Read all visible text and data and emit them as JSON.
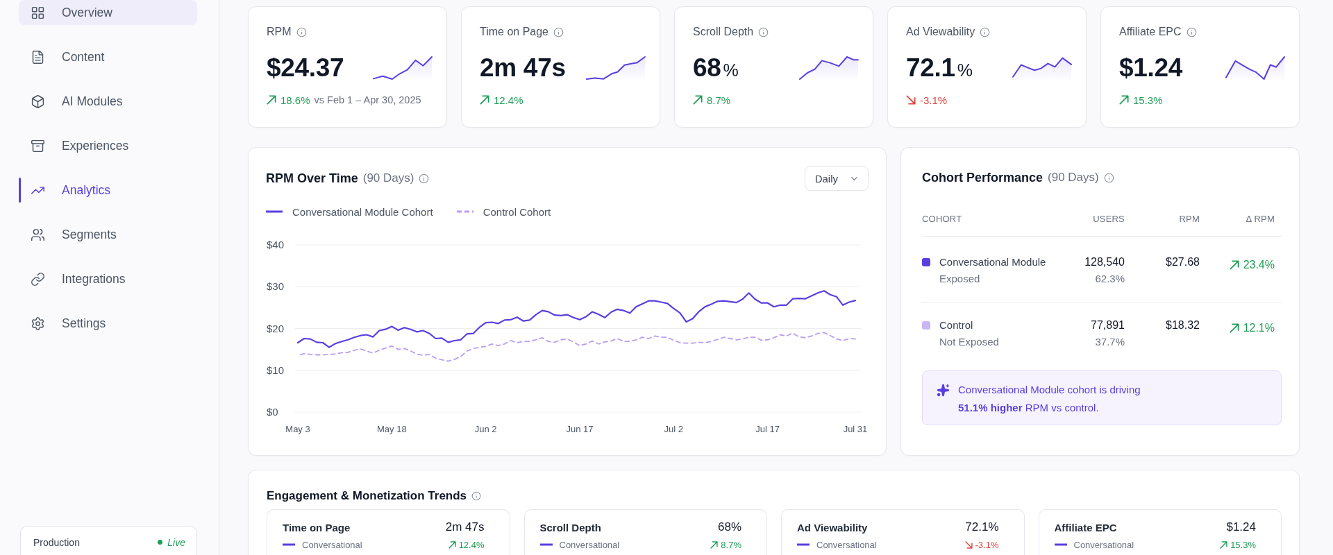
{
  "sidebar": {
    "items": [
      {
        "label": "Overview",
        "selected": false,
        "highlighted": true
      },
      {
        "label": "Content",
        "selected": false,
        "highlighted": false
      },
      {
        "label": "AI Modules",
        "selected": false,
        "highlighted": false
      },
      {
        "label": "Experiences",
        "selected": false,
        "highlighted": false
      },
      {
        "label": "Analytics",
        "selected": true,
        "highlighted": false
      },
      {
        "label": "Segments",
        "selected": false,
        "highlighted": false
      },
      {
        "label": "Integrations",
        "selected": false,
        "highlighted": false
      },
      {
        "label": "Settings",
        "selected": false,
        "highlighted": false
      }
    ],
    "environment": {
      "label": "Production",
      "status": "Live",
      "live": true
    }
  },
  "kpis": [
    {
      "label": "RPM",
      "value": "$24.37",
      "delta": "18.6%",
      "rising": true,
      "comparison": "vs Feb 1 – Apr 30, 2025"
    },
    {
      "label": "Time on Page",
      "value": "2m 47s",
      "delta": "12.4%",
      "rising": true
    },
    {
      "label": "Scroll Depth",
      "value": "68",
      "unit": "%",
      "delta": "8.7%",
      "rising": true
    },
    {
      "label": "Ad Viewability",
      "value": "72.1",
      "unit": "%",
      "delta": "-3.1%",
      "rising": false
    },
    {
      "label": "Affiliate EPC",
      "value": "$1.24",
      "delta": "15.3%",
      "rising": true
    }
  ],
  "rpm_chart": {
    "title": "RPM Over Time",
    "subtitle": "(90 Days)",
    "interval": "Daily",
    "chart_data": {
      "type": "line",
      "categories": [
        "May 3",
        null,
        null,
        null,
        null,
        null,
        null,
        null,
        null,
        null,
        null,
        null,
        null,
        null,
        null,
        "May 18",
        null,
        null,
        null,
        null,
        null,
        null,
        null,
        null,
        null,
        null,
        null,
        null,
        null,
        null,
        "Jun 2",
        null,
        null,
        null,
        null,
        null,
        null,
        null,
        null,
        null,
        null,
        null,
        null,
        null,
        null,
        "Jun 17",
        null,
        null,
        null,
        null,
        null,
        null,
        null,
        null,
        null,
        null,
        null,
        null,
        null,
        null,
        "Jul 2",
        null,
        null,
        null,
        null,
        null,
        null,
        null,
        null,
        null,
        null,
        null,
        null,
        null,
        null,
        "Jul 17",
        null,
        null,
        null,
        null,
        null,
        null,
        null,
        null,
        null,
        null,
        null,
        null,
        null,
        "Jul 31"
      ],
      "series": [
        {
          "name": "Conversational Module Cohort",
          "color": "#5b3ee0",
          "line_style": "solid",
          "values": [
            16.6,
            17.6,
            17.5,
            16.7,
            16.6,
            15.5,
            16.4,
            16.9,
            17.3,
            17.9,
            18.3,
            18.5,
            18.0,
            19.5,
            19.8,
            20.5,
            19.6,
            20.2,
            19.8,
            19.2,
            19.5,
            18.8,
            17.6,
            17.7,
            16.7,
            17.1,
            17.3,
            18.7,
            18.8,
            20.3,
            21.4,
            21.5,
            21.2,
            22.0,
            22.1,
            22.7,
            21.8,
            22.0,
            23.3,
            24.3,
            24.0,
            23.2,
            23.1,
            23.3,
            22.6,
            22.1,
            22.8,
            24.0,
            23.4,
            22.6,
            23.9,
            24.6,
            24.3,
            23.7,
            25.2,
            25.9,
            26.6,
            26.6,
            26.3,
            26.0,
            24.8,
            23.7,
            21.6,
            22.3,
            24.0,
            25.2,
            25.8,
            26.5,
            26.6,
            26.4,
            26.2,
            27.0,
            28.5,
            27.0,
            26.1,
            26.1,
            25.2,
            25.6,
            25.6,
            27.1,
            27.2,
            27.1,
            27.8,
            28.5,
            29.0,
            28.1,
            27.6,
            25.6,
            26.3,
            26.7
          ]
        },
        {
          "name": "Control Cohort",
          "color": "#b89df3",
          "line_style": "dashed",
          "values": [
            13.5,
            14.0,
            13.8,
            13.7,
            13.7,
            13.8,
            13.9,
            14.2,
            14.3,
            14.8,
            15.1,
            14.6,
            14.1,
            14.8,
            15.3,
            15.8,
            15.0,
            15.2,
            14.6,
            13.9,
            13.6,
            13.8,
            12.9,
            12.5,
            12.2,
            12.6,
            13.3,
            14.6,
            15.2,
            15.5,
            15.7,
            16.3,
            15.9,
            16.3,
            17.1,
            16.6,
            16.9,
            16.9,
            17.3,
            17.8,
            16.9,
            16.7,
            17.3,
            17.5,
            16.8,
            15.9,
            16.3,
            17.0,
            16.3,
            16.8,
            17.0,
            17.6,
            16.9,
            16.9,
            17.3,
            17.9,
            17.6,
            18.2,
            17.9,
            17.9,
            17.2,
            16.6,
            16.5,
            16.5,
            16.7,
            16.6,
            16.9,
            17.4,
            17.9,
            17.6,
            17.3,
            17.5,
            17.9,
            17.9,
            17.2,
            17.3,
            17.8,
            18.5,
            18.2,
            18.9,
            18.0,
            17.8,
            18.2,
            18.8,
            19.0,
            18.3,
            17.5,
            17.1,
            17.6,
            17.5
          ]
        }
      ],
      "ylim": [
        0,
        40
      ],
      "yticks": [
        {
          "value": 0,
          "label": "$0"
        },
        {
          "value": 10,
          "label": "$10"
        },
        {
          "value": 20,
          "label": "$20"
        },
        {
          "value": 30,
          "label": "$30"
        },
        {
          "value": 40,
          "label": "$40"
        }
      ],
      "grid": true
    }
  },
  "cohort_performance": {
    "title": "Cohort Performance",
    "subtitle": "(90 Days)",
    "columns": [
      "COHORT",
      "USERS",
      "RPM",
      "Δ RPM"
    ],
    "rows": [
      {
        "name": "Conversational Module",
        "group": "Exposed",
        "color": "#5b3ee0",
        "users": "128,540",
        "share": "62.3%",
        "rpm": "$27.68",
        "delta": "23.4%",
        "rising": true
      },
      {
        "name": "Control",
        "group": "Not Exposed",
        "color": "#c9b6f6",
        "users": "77,891",
        "share": "37.7%",
        "rpm": "$18.32",
        "delta": "12.1%",
        "rising": true
      }
    ],
    "insight": "Conversational Module cohort is driving **51.1% higher** RPM vs control."
  },
  "trends": {
    "title": "Engagement & Monetization Trends",
    "cards": [
      {
        "title": "Time on Page",
        "value": "2m 47s",
        "series_label": "Conversational",
        "delta": "12.4%",
        "rising": true
      },
      {
        "title": "Scroll Depth",
        "value": "68%",
        "series_label": "Conversational",
        "delta": "8.7%",
        "rising": true
      },
      {
        "title": "Ad Viewability",
        "value": "72.1%",
        "series_label": "Conversational",
        "delta": "-3.1%",
        "rising": false
      },
      {
        "title": "Affiliate EPC",
        "value": "$1.24",
        "series_label": "Conversational",
        "delta": "15.3%",
        "rising": true
      }
    ]
  }
}
